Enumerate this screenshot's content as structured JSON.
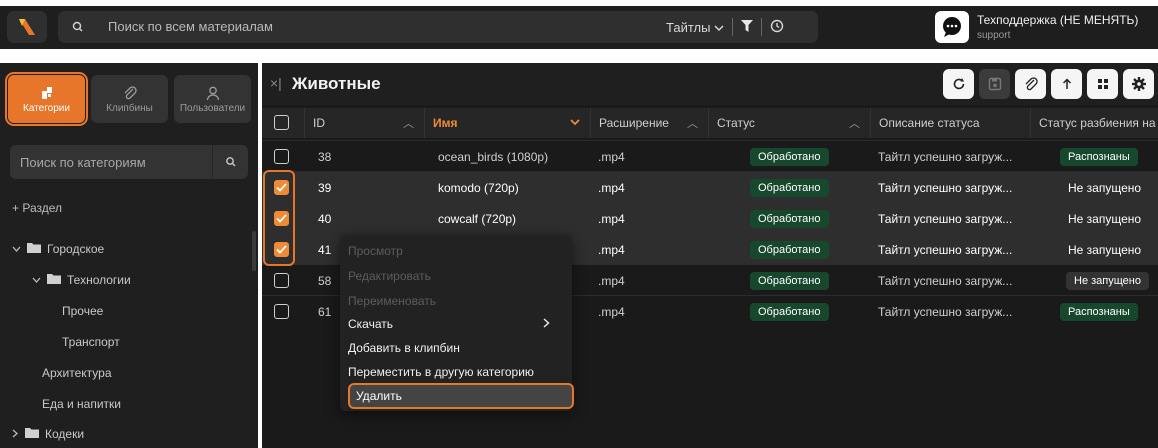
{
  "topbar": {
    "search_placeholder": "Поиск по всем материалам",
    "filter_select": "Тайтлы",
    "support_name": "Техподдержка (НЕ МЕНЯТЬ)",
    "support_sub": "support"
  },
  "sidebar": {
    "tabs": [
      {
        "label": "Категории",
        "icon": "categories-icon",
        "active": true
      },
      {
        "label": "Клипбины",
        "icon": "paperclip-icon",
        "active": false
      },
      {
        "label": "Пользователи",
        "icon": "user-icon",
        "active": false
      }
    ],
    "search_placeholder": "Поиск по категориям",
    "add_section": "+ Раздел",
    "tree": [
      {
        "label": "Городское",
        "level": 0,
        "folder": true,
        "expanded": true
      },
      {
        "label": "Технологии",
        "level": 1,
        "folder": true,
        "expanded": true
      },
      {
        "label": "Прочее",
        "level": 2,
        "folder": false
      },
      {
        "label": "Транспорт",
        "level": 2,
        "folder": false
      },
      {
        "label": "Архитектура",
        "level": 1,
        "folder": false
      },
      {
        "label": "Еда и напитки",
        "level": 1,
        "folder": false
      },
      {
        "label": "Кодеки",
        "level": 0,
        "folder": true,
        "expanded": false
      }
    ]
  },
  "main": {
    "close": "×|",
    "title": "Животные",
    "columns": [
      "ID",
      "Имя",
      "Расширение",
      "Статус",
      "Описание статуса",
      "Статус разбиения на"
    ],
    "rows": [
      {
        "checked": false,
        "id": "38",
        "name": "ocean_birds (1080p)",
        "ext": ".mp4",
        "status": "Обработано",
        "desc": "Тайтл успешно загруж...",
        "split": "Распознаны",
        "split_style": "green"
      },
      {
        "checked": true,
        "id": "39",
        "name": "komodo (720p)",
        "ext": ".mp4",
        "status": "Обработано",
        "desc": "Тайтл успешно загруж...",
        "split": "Не запущено",
        "split_style": "plain"
      },
      {
        "checked": true,
        "id": "40",
        "name": "cowcalf (720p)",
        "ext": ".mp4",
        "status": "Обработано",
        "desc": "Тайтл успешно загруж...",
        "split": "Не запущено",
        "split_style": "plain"
      },
      {
        "checked": true,
        "id": "41",
        "name": "",
        "ext": ".mp4",
        "status": "Обработано",
        "desc": "Тайтл успешно загруж...",
        "split": "Не запущено",
        "split_style": "plain"
      },
      {
        "checked": false,
        "id": "58",
        "name": "",
        "ext": ".mp4",
        "status": "Обработано",
        "desc": "Тайтл успешно загруж...",
        "split": "Не запущено",
        "split_style": "gray"
      },
      {
        "checked": false,
        "id": "61",
        "name": "",
        "ext": ".mp4",
        "status": "Обработано",
        "desc": "Тайтл успешно загруж...",
        "split": "Распознаны",
        "split_style": "green"
      }
    ]
  },
  "context_menu": {
    "items": [
      {
        "label": "Просмотр",
        "disabled": true
      },
      {
        "label": "Редактировать",
        "disabled": true
      },
      {
        "label": "Переименовать",
        "disabled": true
      },
      {
        "label": "Скачать",
        "disabled": false,
        "submenu": true
      },
      {
        "label": "Добавить в клипбин",
        "disabled": false
      },
      {
        "label": "Переместить в другую категорию",
        "disabled": false
      },
      {
        "label": "Удалить",
        "disabled": false,
        "highlighted": true
      }
    ]
  },
  "colors": {
    "accent": "#e8762a",
    "status_green": "#17482e",
    "background": "#1a1a1a"
  }
}
